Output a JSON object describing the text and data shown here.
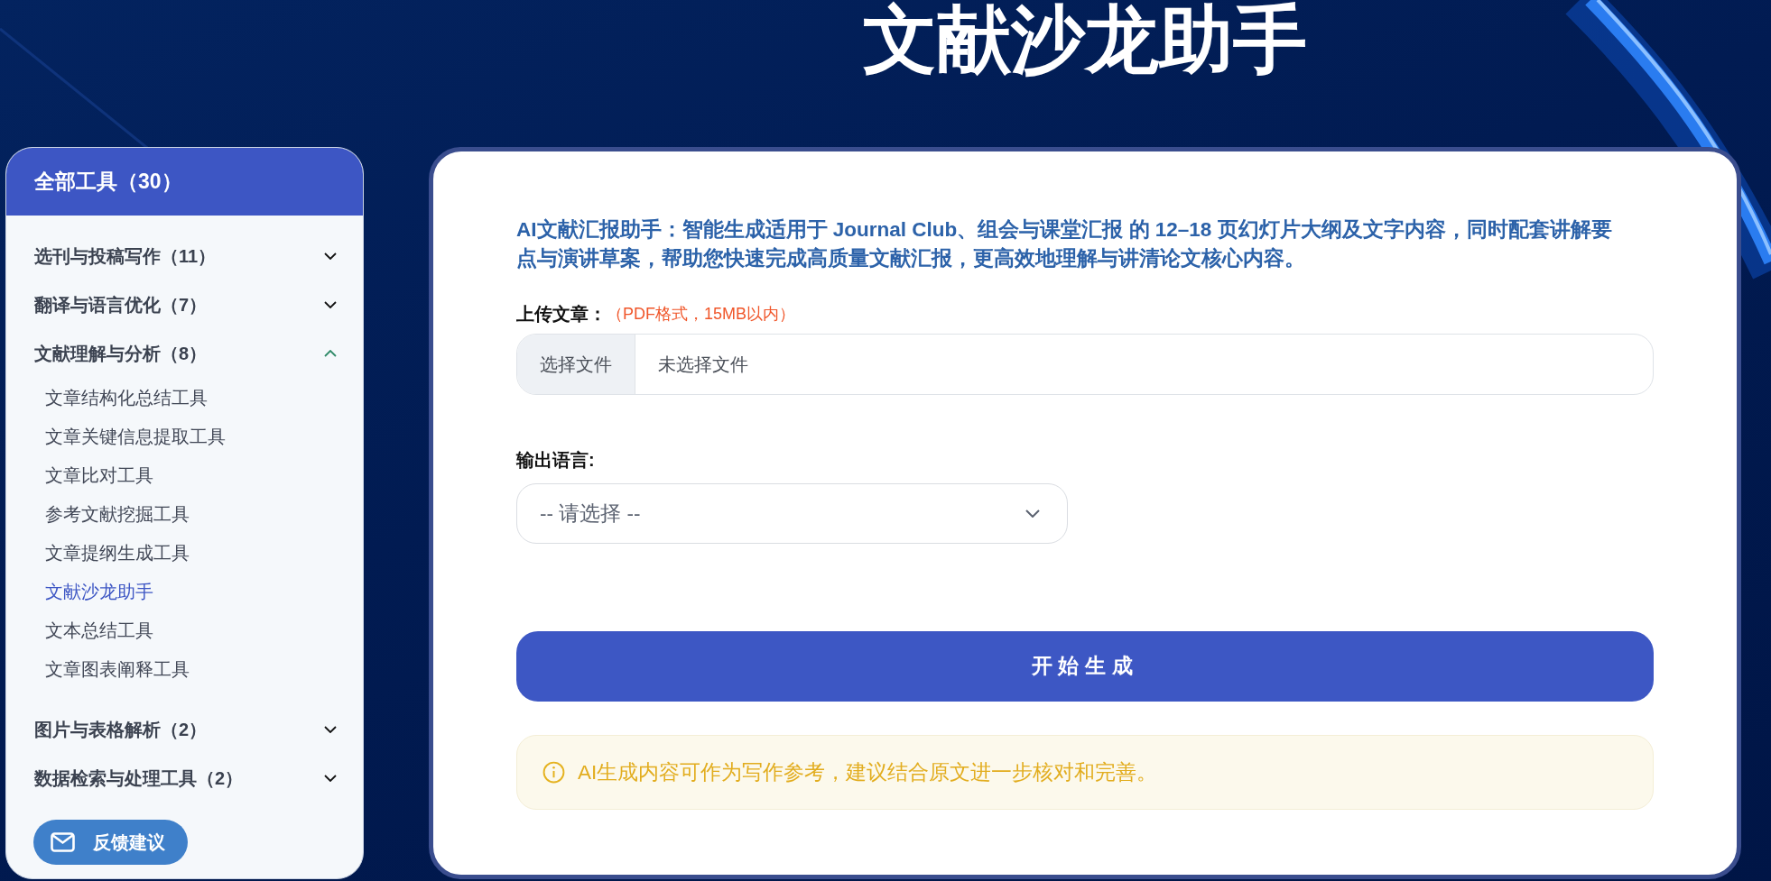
{
  "page_title": "文献沙龙助手",
  "sidebar": {
    "header": "全部工具（30）",
    "categories": [
      {
        "label": "选刊与投稿写作（11）",
        "expanded": false
      },
      {
        "label": "翻译与语言优化（7）",
        "expanded": false
      },
      {
        "label": "文献理解与分析（8）",
        "expanded": true,
        "children": [
          {
            "label": "文章结构化总结工具",
            "selected": false
          },
          {
            "label": "文章关键信息提取工具",
            "selected": false
          },
          {
            "label": "文章比对工具",
            "selected": false
          },
          {
            "label": "参考文献挖掘工具",
            "selected": false
          },
          {
            "label": "文章提纲生成工具",
            "selected": false
          },
          {
            "label": "文献沙龙助手",
            "selected": true
          },
          {
            "label": "文本总结工具",
            "selected": false
          },
          {
            "label": "文章图表阐释工具",
            "selected": false
          }
        ]
      },
      {
        "label": "图片与表格解析（2）",
        "expanded": false
      },
      {
        "label": "数据检索与处理工具（2）",
        "expanded": false
      }
    ],
    "feedback_button": "反馈建议"
  },
  "main": {
    "description": "AI文献汇报助手：智能生成适用于 Journal Club、组会与课堂汇报 的 12–18 页幻灯片大纲及文字内容，同时配套讲解要点与演讲草案，帮助您快速完成高质量文献汇报，更高效地理解与讲清论文核心内容。",
    "upload": {
      "label": "上传文章：",
      "hint": "（PDF格式，15MB以内）",
      "button": "选择文件",
      "status": "未选择文件"
    },
    "language": {
      "label": "输出语言:",
      "placeholder": "-- 请选择 --"
    },
    "submit_button": "开始生成",
    "notice": "AI生成内容可作为写作参考，建议结合原文进一步核对和完善。"
  }
}
